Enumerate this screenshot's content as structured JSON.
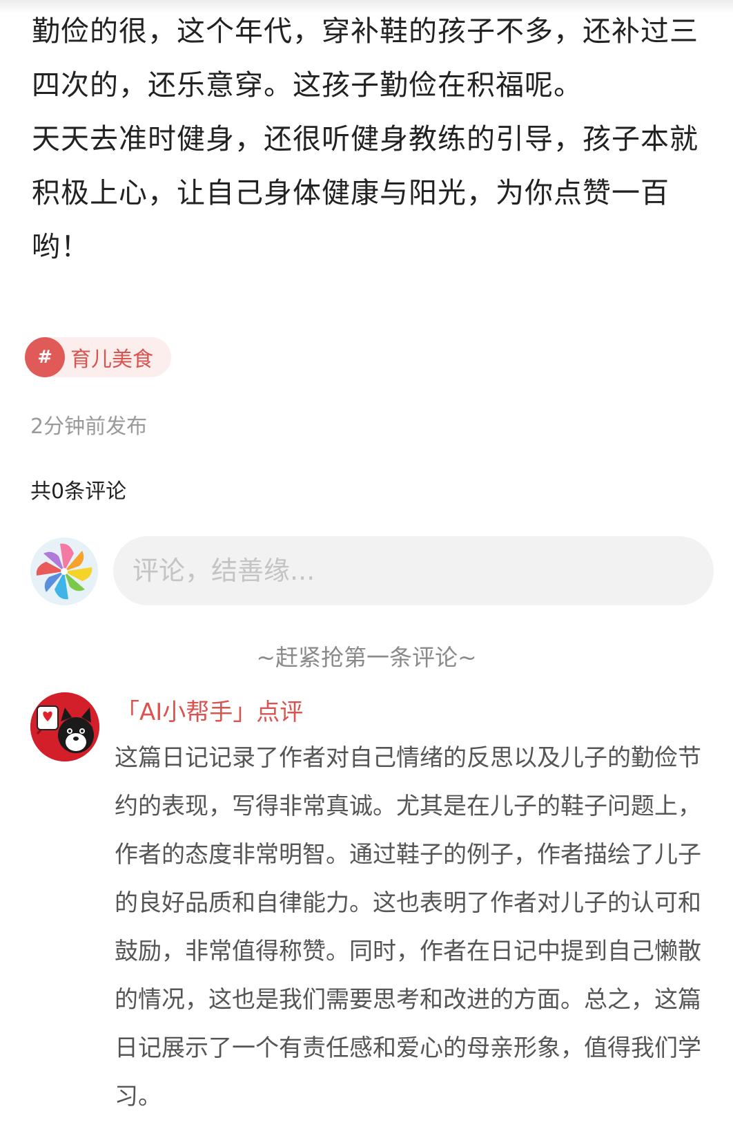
{
  "article": {
    "paragraph_1": "勤俭的很，这个年代，穿补鞋的孩子不多，还补过三四次的，还乐意穿。这孩子勤俭在积福呢。",
    "paragraph_2": "天天去准时健身，还很听健身教练的引导，孩子本就积极上心，让自己身体健康与阳光，为你点赞一百哟！"
  },
  "tag": {
    "symbol": "#",
    "label": "育儿美食"
  },
  "post_meta": {
    "publish_time": "2分钟前发布",
    "comment_count": "共0条评论"
  },
  "comment_box": {
    "placeholder": "评论，结善缘..."
  },
  "empty_hint": "~赶紧抢第一条评论~",
  "ai_review": {
    "title": "「AI小帮手」点评",
    "text": "这篇日记记录了作者对自己情绪的反思以及儿子的勤俭节约的表现，写得非常真诚。尤其是在儿子的鞋子问题上，作者的态度非常明智。通过鞋子的例子，作者描绘了儿子的良好品质和自律能力。这也表明了作者对儿子的认可和鼓励，非常值得称赞。同时，作者在日记中提到自己懒散的情况，这也是我们需要思考和改进的方面。总之，这篇日记展示了一个有责任感和爱心的母亲形象，值得我们学习。"
  },
  "colors": {
    "accent_red": "#d9534f",
    "tag_bg": "#fdeeee",
    "input_bg": "#f2f2f2",
    "muted_text": "#9a9a9a"
  },
  "icons": {
    "user_avatar": "pinwheel-avatar-icon",
    "ai_avatar": "ai-dog-avatar-icon"
  }
}
